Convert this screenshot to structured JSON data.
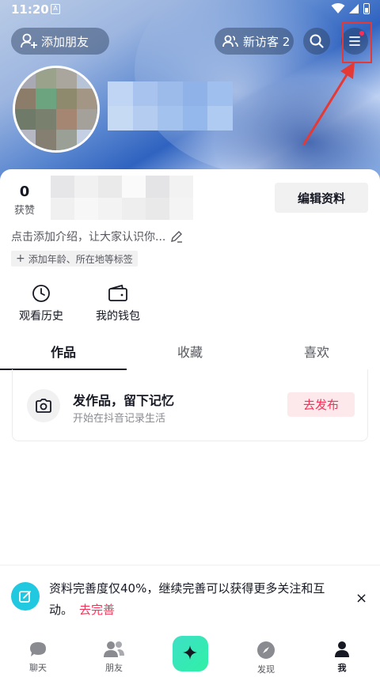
{
  "status_bar": {
    "time": "11:20",
    "sim_icon": "A"
  },
  "header": {
    "add_friend_label": "添加朋友",
    "visitors_label": "新访客 2",
    "icons": [
      "add-user-icon",
      "users-icon",
      "search-icon",
      "menu-icon"
    ]
  },
  "profile": {
    "likes_count": "0",
    "likes_label": "获赞",
    "edit_button_label": "编辑资料",
    "intro_placeholder": "点击添加介绍，让大家认识你...",
    "tag_label": "添加年龄、所在地等标签"
  },
  "shortcuts": [
    {
      "label": "观看历史",
      "icon": "clock-icon"
    },
    {
      "label": "我的钱包",
      "icon": "wallet-icon"
    }
  ],
  "tabs": [
    {
      "label": "作品",
      "active": true
    },
    {
      "label": "收藏",
      "active": false
    },
    {
      "label": "喜欢",
      "active": false
    }
  ],
  "publish_card": {
    "title": "发作品，留下记忆",
    "subtitle": "开始在抖音记录生活",
    "button_label": "去发布"
  },
  "completion_banner": {
    "text": "资料完善度仅40%，继续完善可以获得更多关注和互动。",
    "link_label": "去完善",
    "close_glyph": "×"
  },
  "bottom_nav": [
    {
      "label": "聊天",
      "icon": "chat-icon",
      "active": false
    },
    {
      "label": "朋友",
      "icon": "friends-icon",
      "active": false
    },
    {
      "label": "",
      "icon": "sparkle-icon",
      "active": false
    },
    {
      "label": "发现",
      "icon": "compass-icon",
      "active": false
    },
    {
      "label": "我",
      "icon": "person-icon",
      "active": true
    }
  ],
  "colors": {
    "accent": "#fe2c55",
    "highlight": "#e53935",
    "banner_icon": "#20c9e0",
    "text_primary": "#161823"
  }
}
